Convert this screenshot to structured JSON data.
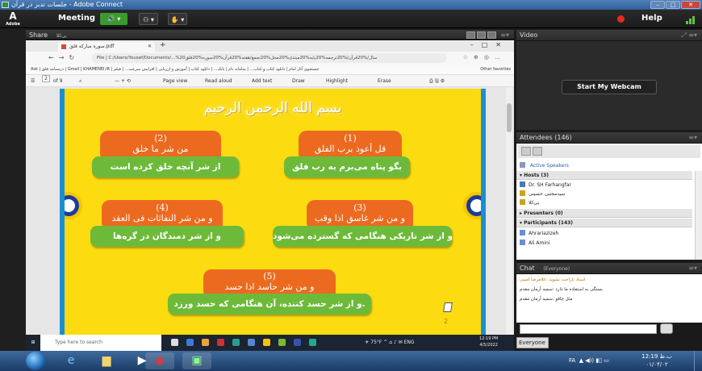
{
  "window": {
    "title": "جلسات تدبر در قرآن - Adobe Connect"
  },
  "menubar": {
    "logo": "Adobe",
    "meeting": "Meeting",
    "help": "Help"
  },
  "share_pod": {
    "title": "Share",
    "subtitle": "بی‌کلا",
    "browser": {
      "tab_title": "سوره مبارکه فلق.pdf",
      "url": "File | C:/Users/Yousef/Documents/...%20سال/%20قرآن/%20ترجمه%20پایه%20مبتدی%20محل%20تجمع/هفته%20قرآن%20سوره%20فلق",
      "bookmarks": "Ask | درسنامه فلق | Gmail | KHAMENEI.IR | جستجوی آثار امام | دانلود کتاب و کتاب... | سامانه بام | بانک... | دانلود کتاب | آموزش و ارزیابی | افزایش سرعت... | فیلم",
      "bookmarks_other": "Other favorites",
      "pdf_page": "2",
      "pdf_of": "of 9",
      "pdf_tools": [
        "Page view",
        "Read aloud",
        "Add text",
        "Draw",
        "Highlight",
        "Erase"
      ]
    },
    "slide": {
      "title": "بسم الله الرحمن الرحیم",
      "page_number": "2",
      "cards": [
        {
          "num": "(1)",
          "arabic": "قل أعوذ برب الفلق",
          "persian": "بگو پناه می‌برم به رب فلق"
        },
        {
          "num": "(2)",
          "arabic": "من شر ما خلق",
          "persian": "از شر آنچه خلق کرده است"
        },
        {
          "num": "(3)",
          "arabic": "و من شر غاسق اذا وقب",
          "persian": "و از شر تاریکی هنگامی که گسترده می‌شود"
        },
        {
          "num": "(4)",
          "arabic": "و من شر النفاثات فی العقد",
          "persian": "و از شر دمندگان در گره‌ها"
        },
        {
          "num": "(5)",
          "arabic": "و من شر حاسد اذا حسد",
          "persian": "و از شر حسد کننده، آن هنگامی که حسد ورزد."
        }
      ]
    },
    "win10_taskbar": {
      "search_placeholder": "Type here to search",
      "weather": "75°F",
      "time": "12:19 PM",
      "date": "4/5/2022"
    }
  },
  "video_pod": {
    "title": "Video",
    "webcam_button": "Start My Webcam"
  },
  "attendees_pod": {
    "title": "Attendees",
    "count": "(146)",
    "active_speakers": "Active Speakers",
    "hosts_label": "Hosts (3)",
    "hosts": [
      "Dr. SH Farhangfar",
      "سیدمجتبی حسینی",
      "بی‌کلا"
    ],
    "presenters_label": "Presenters (0)",
    "participants_label": "Participants (143)",
    "participants": [
      "Ahrariazizeh",
      "Ali Amini"
    ]
  },
  "chat_pod": {
    "title": "Chat",
    "subtitle": "(Everyone)",
    "messages": [
      "استاد ناراحت نشوید :غلامرضا امینی",
      "بستگی به استفاده ما دارد :سمیه آرمان مقدم",
      "مثل چاقو :سمیه آرمان مقدم"
    ],
    "recipient": "Everyone"
  },
  "win7_taskbar": {
    "lang": "FA",
    "time": "12:19 ب.ظ",
    "date": "۰۱/۰۴/۰۲"
  },
  "colors": {
    "slide_bg": "#fcdb11",
    "orange": "#ec6a1f",
    "green": "#6dba3a",
    "blue_border": "#1a8fd0"
  }
}
